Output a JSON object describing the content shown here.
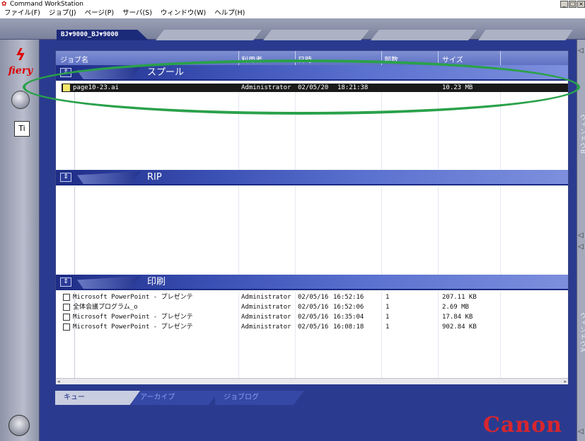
{
  "window": {
    "title": "Command WorkStation",
    "buttons": [
      "_",
      "□",
      "×"
    ]
  },
  "menu": [
    "ファイル(F)",
    "ジョブ(J)",
    "ページ(P)",
    "サーバ(S)",
    "ウィンドウ(W)",
    "ヘルプ(H)"
  ],
  "server_tab": "BJ▼9000_BJ▼9000",
  "brand": {
    "logo_text": "fiery",
    "vendor": "Canon",
    "accent": "#d8262e"
  },
  "columns": [
    "ジョブ名",
    "利用者",
    "日時",
    "部数",
    "サイズ"
  ],
  "sections": {
    "spool": {
      "label": "スプール",
      "rows": [
        {
          "name": "page10-23.ai",
          "user": "Administrator",
          "date": "02/05/20",
          "time": "18:21:38",
          "copies": "",
          "size": "10.23 MB",
          "selected": true
        }
      ]
    },
    "rip": {
      "label": "RIP",
      "rows": []
    },
    "print": {
      "label": "印刷",
      "rows": [
        {
          "name": "Microsoft PowerPoint - プレゼンテ",
          "user": "Administrator",
          "date": "02/05/16",
          "time": "16:52:16",
          "copies": "1",
          "size": "207.11 KB"
        },
        {
          "name": "全体会議プログラム_o",
          "user": "Administrator",
          "date": "02/05/16",
          "time": "16:52:06",
          "copies": "1",
          "size": "2.69 MB"
        },
        {
          "name": "Microsoft PowerPoint - プレゼンテ",
          "user": "Administrator",
          "date": "02/05/16",
          "time": "16:35:04",
          "copies": "1",
          "size": "17.84 KB"
        },
        {
          "name": "Microsoft PowerPoint - プレゼンテ",
          "user": "Administrator",
          "date": "02/05/16",
          "time": "16:08:18",
          "copies": "1",
          "size": "902.84 KB"
        }
      ]
    }
  },
  "bottom_tabs": [
    "キュー",
    "アーカイブ",
    "ジョブログ"
  ],
  "right_panel_labels": [
    "ウィンドウB",
    "ウィンドウA"
  ],
  "icons": {
    "app": "fiery-app-icon",
    "side": [
      "fiery-logo-icon",
      "disc-icon",
      "tools-icon",
      "database-icon"
    ]
  },
  "annotation_color": "#2aa14a"
}
